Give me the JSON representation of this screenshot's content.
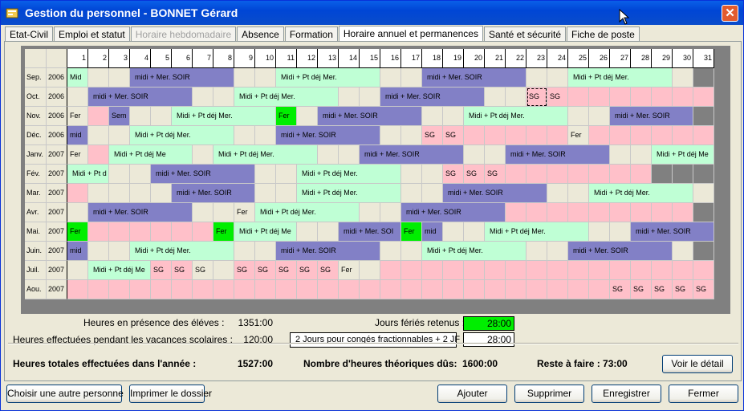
{
  "window": {
    "title": "Gestion du personnel - BONNET Gérard",
    "close_symbol": "✕"
  },
  "tabs": [
    "Etat-Civil",
    "Emploi et statut",
    "Horaire hebdomadaire",
    "Absence",
    "Formation",
    "Horaire annuel et permanences",
    "Santé et sécurité",
    "Fiche de poste"
  ],
  "active_tab": 5,
  "disabled_tab": 2,
  "colors": {
    "green": "#BFFFD5",
    "blue": "#8280C6",
    "pink": "#FFC0C9",
    "bright_green": "#00EE00",
    "empty": "#ECE9D8",
    "gray": "#808080"
  },
  "calendar": {
    "days": [
      "1",
      "2",
      "3",
      "4",
      "5",
      "6",
      "7",
      "8",
      "9",
      "10",
      "11",
      "12",
      "13",
      "14",
      "15",
      "16",
      "17",
      "18",
      "19",
      "20",
      "21",
      "22",
      "23",
      "24",
      "25",
      "26",
      "27",
      "28",
      "29",
      "30",
      "31"
    ],
    "rows": [
      {
        "month": "Sep.",
        "year": "2006",
        "segs": [
          [
            "Mid",
            "g",
            1,
            1
          ],
          [
            "",
            "e",
            2,
            3
          ],
          [
            "midi + Mer. SOIR",
            "b",
            4,
            8
          ],
          [
            "",
            "e",
            9,
            10
          ],
          [
            "Midi + Pt déj Mer.",
            "g",
            11,
            15
          ],
          [
            "",
            "e",
            16,
            17
          ],
          [
            "midi + Mer. SOIR",
            "b",
            18,
            22
          ],
          [
            "",
            "e",
            23,
            24
          ],
          [
            "Midi + Pt déj Mer.",
            "g",
            25,
            29
          ],
          [
            "",
            "e",
            30,
            30
          ],
          [
            "",
            "x",
            31,
            31
          ]
        ]
      },
      {
        "month": "Oct.",
        "year": "2006",
        "segs": [
          [
            "",
            "e",
            1,
            1
          ],
          [
            "midi + Mer. SOIR",
            "b",
            2,
            6
          ],
          [
            "",
            "e",
            7,
            8
          ],
          [
            "Midi + Pt déj Mer.",
            "g",
            9,
            13
          ],
          [
            "",
            "e",
            14,
            15
          ],
          [
            "midi + Mer. SOIR",
            "b",
            16,
            20
          ],
          [
            "",
            "e",
            21,
            22
          ],
          [
            "SG",
            "p",
            23,
            23,
            "sel"
          ],
          [
            "SG",
            "p",
            24,
            24
          ],
          [
            "",
            "p",
            25,
            31
          ]
        ]
      },
      {
        "month": "Nov.",
        "year": "2006",
        "segs": [
          [
            "Fer",
            "e",
            1,
            1
          ],
          [
            "",
            "p",
            2,
            2
          ],
          [
            "Sem",
            "b",
            3,
            3
          ],
          [
            "",
            "e",
            4,
            5
          ],
          [
            "Midi + Pt déj Mer.",
            "g",
            6,
            10
          ],
          [
            "Fer",
            "G",
            11,
            11
          ],
          [
            "",
            "e",
            12,
            12
          ],
          [
            "midi + Mer. SOIR",
            "b",
            13,
            17
          ],
          [
            "",
            "e",
            18,
            19
          ],
          [
            "Midi + Pt déj Mer.",
            "g",
            20,
            24
          ],
          [
            "",
            "e",
            25,
            26
          ],
          [
            "midi + Mer. SOIR",
            "b",
            27,
            30
          ],
          [
            "",
            "x",
            31,
            31
          ]
        ]
      },
      {
        "month": "Déc.",
        "year": "2006",
        "segs": [
          [
            "mid",
            "b",
            1,
            1
          ],
          [
            "",
            "e",
            2,
            3
          ],
          [
            "Midi + Pt déj Mer.",
            "g",
            4,
            8
          ],
          [
            "",
            "e",
            9,
            10
          ],
          [
            "midi + Mer. SOIR",
            "b",
            11,
            15
          ],
          [
            "",
            "e",
            16,
            17
          ],
          [
            "SG",
            "p",
            18,
            18
          ],
          [
            "SG",
            "p",
            19,
            19
          ],
          [
            "",
            "p",
            20,
            24
          ],
          [
            "Fer",
            "e",
            25,
            25
          ],
          [
            "",
            "p",
            26,
            31
          ]
        ]
      },
      {
        "month": "Janv.",
        "year": "2007",
        "segs": [
          [
            "Fer",
            "e",
            1,
            1
          ],
          [
            "",
            "p",
            2,
            2
          ],
          [
            "Midi + Pt déj Me",
            "g",
            3,
            6
          ],
          [
            "",
            "e",
            7,
            7
          ],
          [
            "Midi + Pt déj Mer.",
            "g",
            8,
            12
          ],
          [
            "",
            "e",
            13,
            14
          ],
          [
            "midi + Mer. SOIR",
            "b",
            15,
            19
          ],
          [
            "",
            "e",
            20,
            21
          ],
          [
            "midi + Mer. SOIR",
            "b",
            22,
            26
          ],
          [
            "",
            "e",
            27,
            28
          ],
          [
            "Midi + Pt déj Me",
            "g",
            29,
            31
          ]
        ]
      },
      {
        "month": "Fév.",
        "year": "2007",
        "segs": [
          [
            "Midi + Pt d",
            "g",
            1,
            2
          ],
          [
            "",
            "e",
            3,
            4
          ],
          [
            "midi + Mer. SOIR",
            "b",
            5,
            9
          ],
          [
            "",
            "e",
            10,
            11
          ],
          [
            "Midi + Pt déj Mer.",
            "g",
            12,
            16
          ],
          [
            "",
            "e",
            17,
            18
          ],
          [
            "SG",
            "p",
            19,
            19
          ],
          [
            "SG",
            "p",
            20,
            20
          ],
          [
            "SG",
            "p",
            21,
            21
          ],
          [
            "",
            "p",
            22,
            28
          ],
          [
            "",
            "x",
            29,
            31
          ]
        ]
      },
      {
        "month": "Mar.",
        "year": "2007",
        "segs": [
          [
            "",
            "p",
            1,
            1
          ],
          [
            "",
            "e",
            2,
            5
          ],
          [
            "midi + Mer. SOIR",
            "b",
            6,
            9
          ],
          [
            "",
            "e",
            10,
            11
          ],
          [
            "Midi + Pt déj Mer.",
            "g",
            12,
            16
          ],
          [
            "",
            "e",
            17,
            18
          ],
          [
            "midi + Mer. SOIR",
            "b",
            19,
            23
          ],
          [
            "",
            "e",
            24,
            25
          ],
          [
            "Midi + Pt déj Mer.",
            "g",
            26,
            30
          ],
          [
            "",
            "e",
            31,
            31
          ]
        ]
      },
      {
        "month": "Avr.",
        "year": "2007",
        "segs": [
          [
            "",
            "e",
            1,
            1
          ],
          [
            "midi + Mer. SOIR",
            "b",
            2,
            6
          ],
          [
            "",
            "e",
            7,
            8
          ],
          [
            "Fer",
            "e",
            9,
            9
          ],
          [
            "Midi + Pt déj Mer.",
            "g",
            10,
            14
          ],
          [
            "",
            "e",
            15,
            16
          ],
          [
            "midi + Mer. SOIR",
            "b",
            17,
            21
          ],
          [
            "",
            "p",
            22,
            30
          ],
          [
            "",
            "x",
            31,
            31
          ]
        ]
      },
      {
        "month": "Mai.",
        "year": "2007",
        "segs": [
          [
            "Fer",
            "G",
            1,
            1
          ],
          [
            "",
            "p",
            2,
            7
          ],
          [
            "Fer",
            "G",
            8,
            8
          ],
          [
            "Midi + Pt déj Me",
            "g",
            9,
            11
          ],
          [
            "",
            "e",
            12,
            13
          ],
          [
            "midi + Mer. SOI",
            "b",
            14,
            16
          ],
          [
            "Fer",
            "G",
            17,
            17
          ],
          [
            "mid",
            "b",
            18,
            18
          ],
          [
            "",
            "e",
            19,
            20
          ],
          [
            "Midi + Pt déj Mer.",
            "g",
            21,
            25
          ],
          [
            "",
            "e",
            26,
            27
          ],
          [
            "midi + Mer. SOIR",
            "b",
            28,
            31
          ]
        ]
      },
      {
        "month": "Juin.",
        "year": "2007",
        "segs": [
          [
            "mid",
            "b",
            1,
            1
          ],
          [
            "",
            "e",
            2,
            3
          ],
          [
            "Midi + Pt déj Mer.",
            "g",
            4,
            8
          ],
          [
            "",
            "e",
            9,
            10
          ],
          [
            "midi + Mer. SOIR",
            "b",
            11,
            15
          ],
          [
            "",
            "e",
            16,
            17
          ],
          [
            "Midi + Pt déj Mer.",
            "g",
            18,
            22
          ],
          [
            "",
            "e",
            23,
            24
          ],
          [
            "midi + Mer. SOIR",
            "b",
            25,
            29
          ],
          [
            "",
            "e",
            30,
            30
          ],
          [
            "",
            "x",
            31,
            31
          ]
        ]
      },
      {
        "month": "Juil.",
        "year": "2007",
        "segs": [
          [
            "",
            "e",
            1,
            1
          ],
          [
            "Midi + Pt déj Me",
            "g",
            2,
            4
          ],
          [
            "SG",
            "p",
            5,
            5
          ],
          [
            "SG",
            "p",
            6,
            6
          ],
          [
            "SG",
            "e",
            7,
            7
          ],
          [
            "",
            "e",
            8,
            8
          ],
          [
            "SG",
            "p",
            9,
            9
          ],
          [
            "SG",
            "p",
            10,
            10
          ],
          [
            "SG",
            "p",
            11,
            11
          ],
          [
            "SG",
            "p",
            12,
            12
          ],
          [
            "SG",
            "p",
            13,
            13
          ],
          [
            "Fer",
            "e",
            14,
            14
          ],
          [
            "",
            "e",
            15,
            15
          ],
          [
            "",
            "p",
            16,
            31
          ]
        ]
      },
      {
        "month": "Aou.",
        "year": "2007",
        "segs": [
          [
            "",
            "p",
            1,
            26
          ],
          [
            "SG",
            "p",
            27,
            27
          ],
          [
            "SG",
            "p",
            28,
            28
          ],
          [
            "SG",
            "p",
            29,
            29
          ],
          [
            "SG",
            "p",
            30,
            30
          ],
          [
            "SG",
            "p",
            31,
            31
          ]
        ]
      }
    ]
  },
  "summary": {
    "presence_label": "Heures en présence des éléves :",
    "presence_value": "1351:00",
    "vacances_label": "Heures effectuées pendant les vacances scolaires :",
    "vacances_value": "120:00",
    "feries_label": "Jours fériés retenus :",
    "feries_value": "28:00",
    "conges_label": "2 Jours pour congés fractionnables + 2 JF",
    "conges_value": "28:00",
    "total_label": "Heures totales effectuées dans l'année :",
    "total_value": "1527:00",
    "theo_label": "Nombre d'heures théoriques dûs:",
    "theo_value": "1600:00",
    "reste_label": "Reste à faire : 73:00",
    "detail_btn": "Voir le détail"
  },
  "buttons": {
    "choose": "Choisir une autre personne",
    "print": "Imprimer le dossier",
    "add": "Ajouter",
    "delete": "Supprimer",
    "save": "Enregistrer",
    "close": "Fermer"
  }
}
